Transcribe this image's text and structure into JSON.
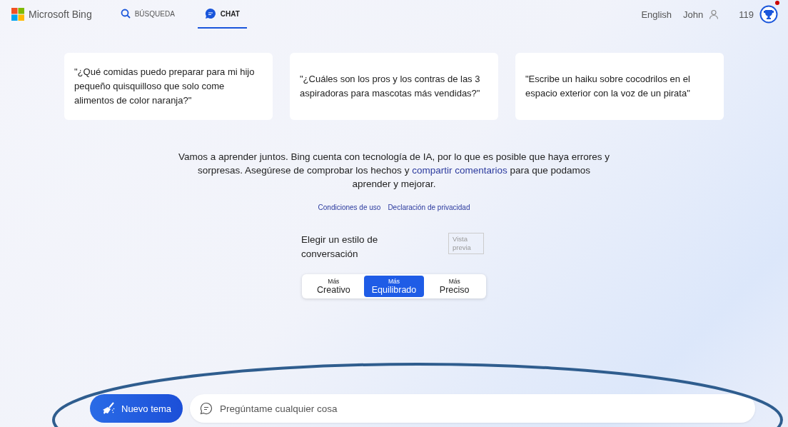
{
  "header": {
    "brand": "Microsoft Bing",
    "tabs": [
      {
        "label": "BÚSQUEDA",
        "kind": "search",
        "selected": false
      },
      {
        "label": "CHAT",
        "kind": "chat",
        "selected": true
      }
    ],
    "language": "English",
    "user": "John",
    "points": "119",
    "notification": true
  },
  "suggestions": [
    "\"¿Qué comidas puedo preparar para mi hijo pequeño quisquilloso que solo come alimentos de color naranja?\"",
    "\"¿Cuáles son los pros y los contras de las 3 aspiradoras para mascotas más vendidas?\"",
    "\"Escribe un haiku sobre cocodrilos en el espacio exterior con la voz de un pirata\""
  ],
  "disclaimer": {
    "before": "Vamos a aprender juntos. Bing cuenta con tecnología de IA, por lo que es posible que haya errores y sorpresas. Asegúrese de comprobar los hechos y ",
    "link": "compartir comentarios",
    "after": " para que podamos aprender y mejorar."
  },
  "links": [
    "Condiciones de uso",
    "Declaración de privacidad"
  ],
  "style_picker": {
    "title": "Elegir un estilo de conversación",
    "badge": "Vista previa",
    "options": [
      {
        "prefix": "Más",
        "label": "Creativo",
        "selected": false
      },
      {
        "prefix": "Más",
        "label": "Equilibrado",
        "selected": true
      },
      {
        "prefix": "Más",
        "label": "Preciso",
        "selected": false
      }
    ]
  },
  "composer": {
    "new_topic": "Nuevo tema",
    "placeholder": "Pregúntame cualquier cosa"
  }
}
